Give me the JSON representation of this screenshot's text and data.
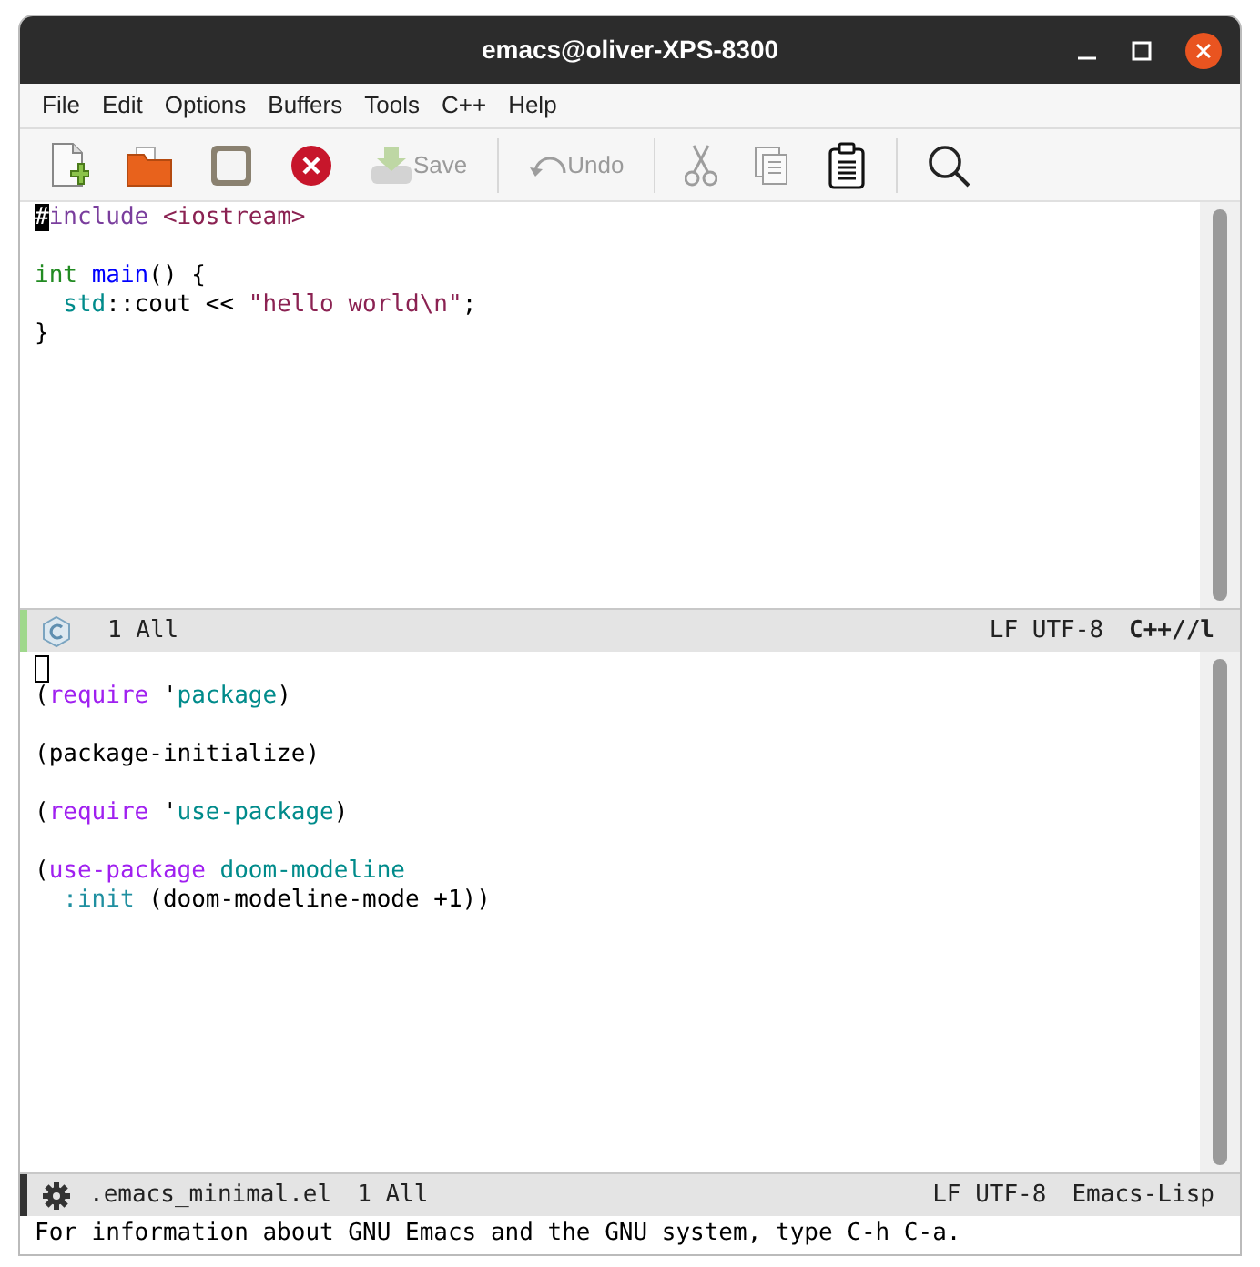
{
  "window": {
    "title": "emacs@oliver-XPS-8300"
  },
  "menu": [
    "File",
    "Edit",
    "Options",
    "Buffers",
    "Tools",
    "C++",
    "Help"
  ],
  "toolbar": [
    {
      "kind": "button",
      "disabled": false
    },
    {
      "kind": "button",
      "disabled": false
    },
    {
      "kind": "button",
      "disabled": false
    },
    {
      "kind": "button",
      "disabled": false
    },
    {
      "kind": "button",
      "disabled": true,
      "label": "Save"
    },
    {
      "kind": "separator"
    },
    {
      "kind": "button",
      "disabled": true,
      "label": "Undo"
    },
    {
      "kind": "separator"
    },
    {
      "kind": "button",
      "disabled": true
    },
    {
      "kind": "button",
      "disabled": true
    },
    {
      "kind": "button",
      "disabled": false
    },
    {
      "kind": "separator"
    },
    {
      "kind": "button",
      "disabled": false
    }
  ],
  "panes": [
    {
      "lines": [
        {
          "kind": "code",
          "tokens": [
            {
              "text": "#",
              "kind": "cursor"
            },
            {
              "text": "include ",
              "kind": "preprocessor"
            },
            {
              "text": "<iostream>",
              "kind": "string"
            }
          ]
        },
        {
          "kind": "blank"
        },
        {
          "kind": "code",
          "tokens": [
            {
              "text": "int ",
              "kind": "type"
            },
            {
              "text": "main",
              "kind": "function"
            },
            {
              "text": "() {",
              "kind": "plain"
            }
          ]
        },
        {
          "kind": "code",
          "tokens": [
            {
              "text": "  std",
              "kind": "constant"
            },
            {
              "text": "::cout << ",
              "kind": "plain"
            },
            {
              "text": "\"hello world\\n\"",
              "kind": "string"
            },
            {
              "text": ";",
              "kind": "plain"
            }
          ]
        },
        {
          "kind": "code",
          "tokens": [
            {
              "text": "}",
              "kind": "plain"
            }
          ]
        }
      ],
      "modeline": {
        "active": true,
        "kind": "cpp",
        "position": "1 All",
        "encoding": "LF UTF-8",
        "mode": "C++//l",
        "mode_bold": true
      }
    },
    {
      "lines": [
        {
          "kind": "cursor"
        },
        {
          "kind": "code",
          "tokens": [
            {
              "text": "(",
              "kind": "plain"
            },
            {
              "text": "require",
              "kind": "keyword"
            },
            {
              "text": " '",
              "kind": "plain"
            },
            {
              "text": "package",
              "kind": "constant"
            },
            {
              "text": ")",
              "kind": "plain"
            }
          ]
        },
        {
          "kind": "blank"
        },
        {
          "kind": "code",
          "tokens": [
            {
              "text": "(package-initialize)",
              "kind": "plain"
            }
          ]
        },
        {
          "kind": "blank"
        },
        {
          "kind": "code",
          "tokens": [
            {
              "text": "(",
              "kind": "plain"
            },
            {
              "text": "require",
              "kind": "keyword"
            },
            {
              "text": " '",
              "kind": "plain"
            },
            {
              "text": "use-package",
              "kind": "constant"
            },
            {
              "text": ")",
              "kind": "plain"
            }
          ]
        },
        {
          "kind": "blank"
        },
        {
          "kind": "code",
          "tokens": [
            {
              "text": "(",
              "kind": "plain"
            },
            {
              "text": "use-package ",
              "kind": "keyword"
            },
            {
              "text": "doom-modeline",
              "kind": "constant"
            }
          ]
        },
        {
          "kind": "code",
          "tokens": [
            {
              "text": "  :init",
              "kind": "builtin"
            },
            {
              "text": " (doom-modeline-mode +1))",
              "kind": "plain"
            }
          ]
        }
      ],
      "modeline": {
        "active": false,
        "kind": "elisp",
        "buffer": ".emacs_minimal.el",
        "position": "1 All",
        "encoding": "LF UTF-8",
        "mode": "Emacs-Lisp",
        "mode_bold": false
      }
    }
  ],
  "echo_area": "For information about GNU Emacs and the GNU system, type C-h C-a."
}
